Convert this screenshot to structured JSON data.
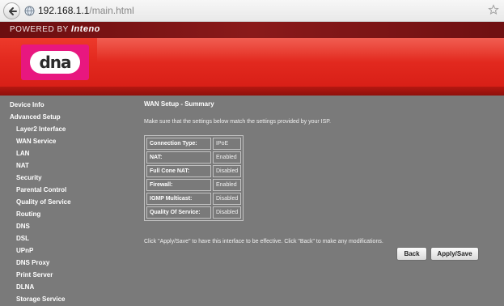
{
  "browser": {
    "url_host": "192.168.1.1",
    "url_path": "/main.html"
  },
  "header": {
    "powered_by": "POWERED BY",
    "powered_brand": "Inteno",
    "logo_text": "dna",
    "colors": {
      "brand_red": "#e32a1f",
      "brand_pink": "#e8177f",
      "dark_red": "#6b0e10"
    }
  },
  "menu": {
    "items": [
      {
        "label": "Device Info",
        "level": 0
      },
      {
        "label": "Advanced Setup",
        "level": 0
      },
      {
        "label": "Layer2 Interface",
        "level": 1
      },
      {
        "label": "WAN Service",
        "level": 1
      },
      {
        "label": "LAN",
        "level": 1
      },
      {
        "label": "NAT",
        "level": 1
      },
      {
        "label": "Security",
        "level": 1
      },
      {
        "label": "Parental Control",
        "level": 1
      },
      {
        "label": "Quality of Service",
        "level": 1
      },
      {
        "label": "Routing",
        "level": 1
      },
      {
        "label": "DNS",
        "level": 1
      },
      {
        "label": "DSL",
        "level": 1
      },
      {
        "label": "UPnP",
        "level": 1
      },
      {
        "label": "DNS Proxy",
        "level": 1
      },
      {
        "label": "Print Server",
        "level": 1
      },
      {
        "label": "DLNA",
        "level": 1
      },
      {
        "label": "Storage Service",
        "level": 1
      }
    ]
  },
  "main": {
    "title": "WAN Setup - Summary",
    "intro": "Make sure that the settings below match the settings provided by your ISP.",
    "summary": [
      {
        "key": "Connection Type:",
        "value": "IPoE"
      },
      {
        "key": "NAT:",
        "value": "Enabled"
      },
      {
        "key": "Full Cone NAT:",
        "value": "Disabled"
      },
      {
        "key": "Firewall:",
        "value": "Enabled"
      },
      {
        "key": "IGMP Multicast:",
        "value": "Disabled"
      },
      {
        "key": "Quality Of Service:",
        "value": "Disabled"
      }
    ],
    "hint": "Click \"Apply/Save\" to have this interface to be effective. Click \"Back\" to make any modifications.",
    "back_label": "Back",
    "apply_label": "Apply/Save"
  }
}
